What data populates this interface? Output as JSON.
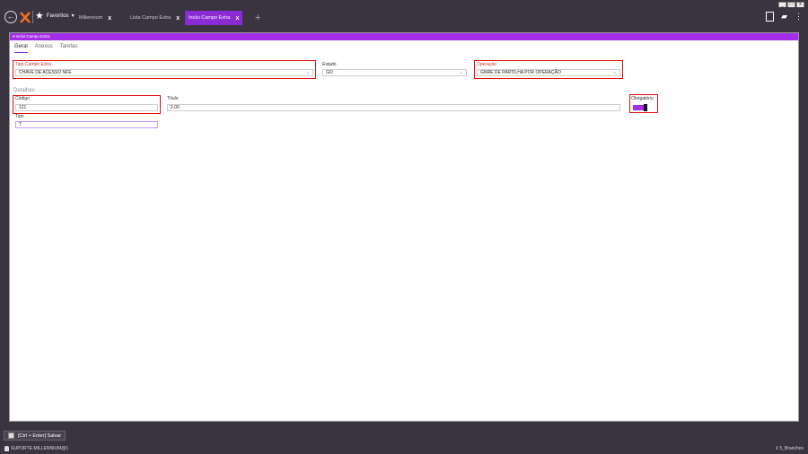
{
  "window": {
    "minimize": "_",
    "maximize": "□",
    "close": "x"
  },
  "topbar": {
    "favorites_label": "Favoritos",
    "favorites_caret": "▾",
    "tabs": [
      {
        "label": "Millennium",
        "close": "x"
      },
      {
        "label": "Lista Campo Extra",
        "close": "x"
      },
      {
        "label": "Inclui Campo Extra",
        "close": "x"
      }
    ],
    "add_tab": "+"
  },
  "panel": {
    "header": "▾ Inclui Campo Extra",
    "tabs": [
      "Geral",
      "Anexos",
      "Tarefas"
    ]
  },
  "form": {
    "tipo_campo_extra": {
      "label": "Tipo Campo Extra",
      "value": "CHAVE DE ACESSO NFE"
    },
    "estado": {
      "label": "Estado",
      "value": "GO"
    },
    "operacao": {
      "label": "Operação",
      "value": "GNRE DE PARTILHA POR OPERAÇÃO"
    },
    "detalhes_section": "Detalhes",
    "codigo": {
      "label": "Código",
      "value": "121"
    },
    "titulo": {
      "label": "Título",
      "value": "2.00"
    },
    "obrigatorio": {
      "label": "Obrigatório",
      "value": true
    },
    "tipo": {
      "label": "Tipo",
      "value": "T"
    }
  },
  "colors": {
    "accent": "#a42ee8",
    "highlight": "#e01010",
    "background": "#3a3340"
  },
  "footer": {
    "save_label": "[Ctrl + Enter] Salvar",
    "user": "SUPORTE.MILLENNIUM@1",
    "branch": "5_Branches"
  }
}
